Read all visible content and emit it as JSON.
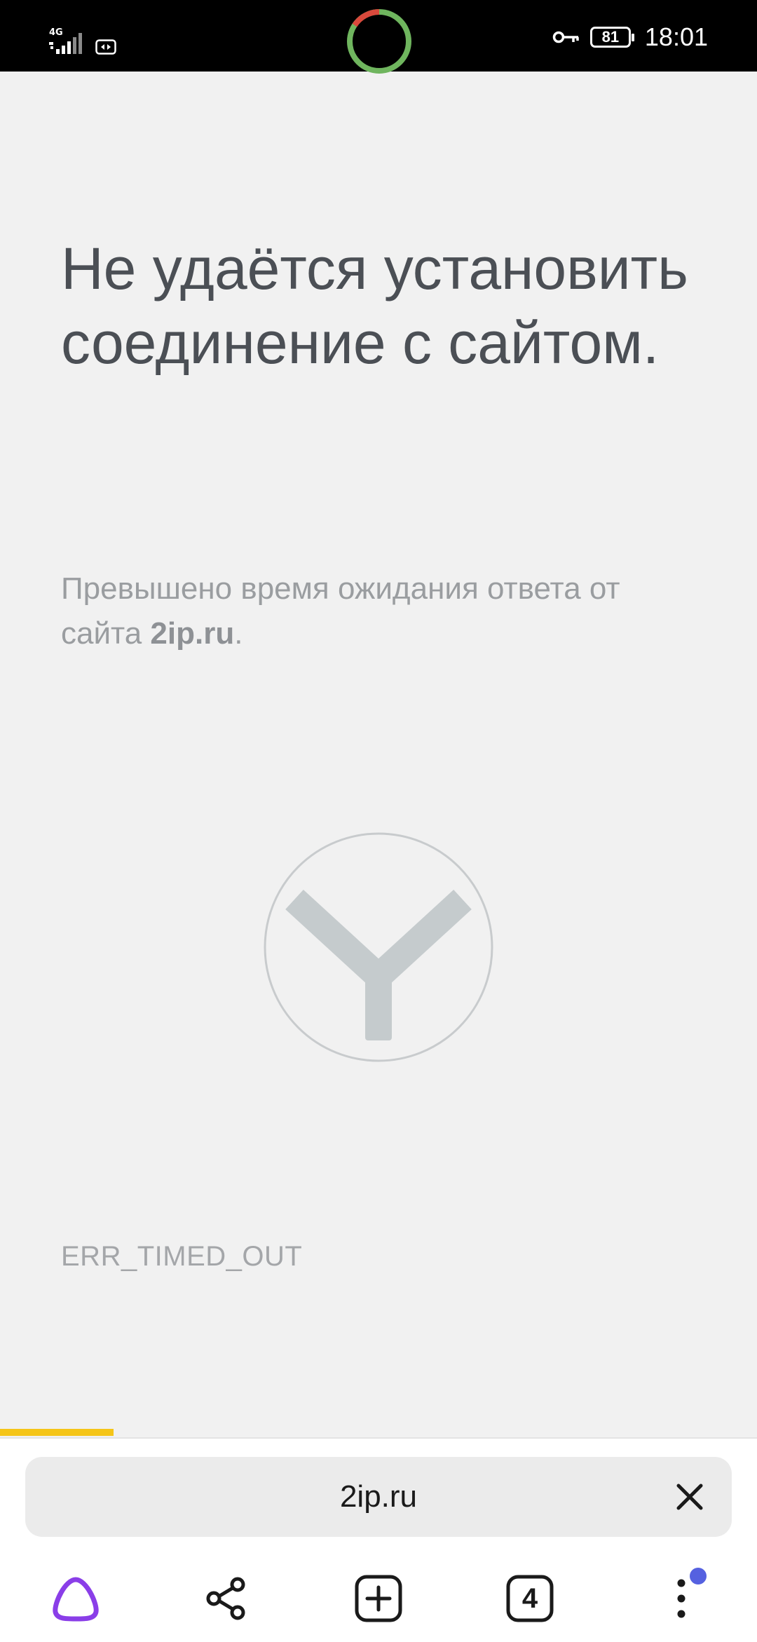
{
  "status_bar": {
    "network_label": "4G",
    "battery_level": "81",
    "time": "18:01",
    "icons": [
      "signal-icon",
      "sim-icon",
      "loading-ring-icon",
      "vpn-key-icon",
      "battery-icon"
    ]
  },
  "error": {
    "title": "Не удаётся установить соединение с сайтом.",
    "description_prefix": "Превышено время ожидания ответа от сайта ",
    "site": "2ip.ru",
    "description_suffix": ".",
    "code": "ERR_TIMED_OUT",
    "logo_icon": "yandex-browser-logo-icon"
  },
  "address_bar": {
    "url": "2ip.ru",
    "clear_icon": "close-icon"
  },
  "toolbar": {
    "tabs_count": "4",
    "icons": [
      "alice-icon",
      "share-icon",
      "new-tab-icon",
      "tabs-icon",
      "menu-icon"
    ]
  },
  "colors": {
    "page_background": "#f1f1f1",
    "title": "#4b4f55",
    "muted_text": "#9a9da0",
    "progress_bar": "#f5c518",
    "alice_purple": "#8a3ee8",
    "notification_dot": "#5561e0",
    "ring_green": "#6fb55e",
    "ring_red": "#d9493c"
  },
  "load_progress": 0.15
}
